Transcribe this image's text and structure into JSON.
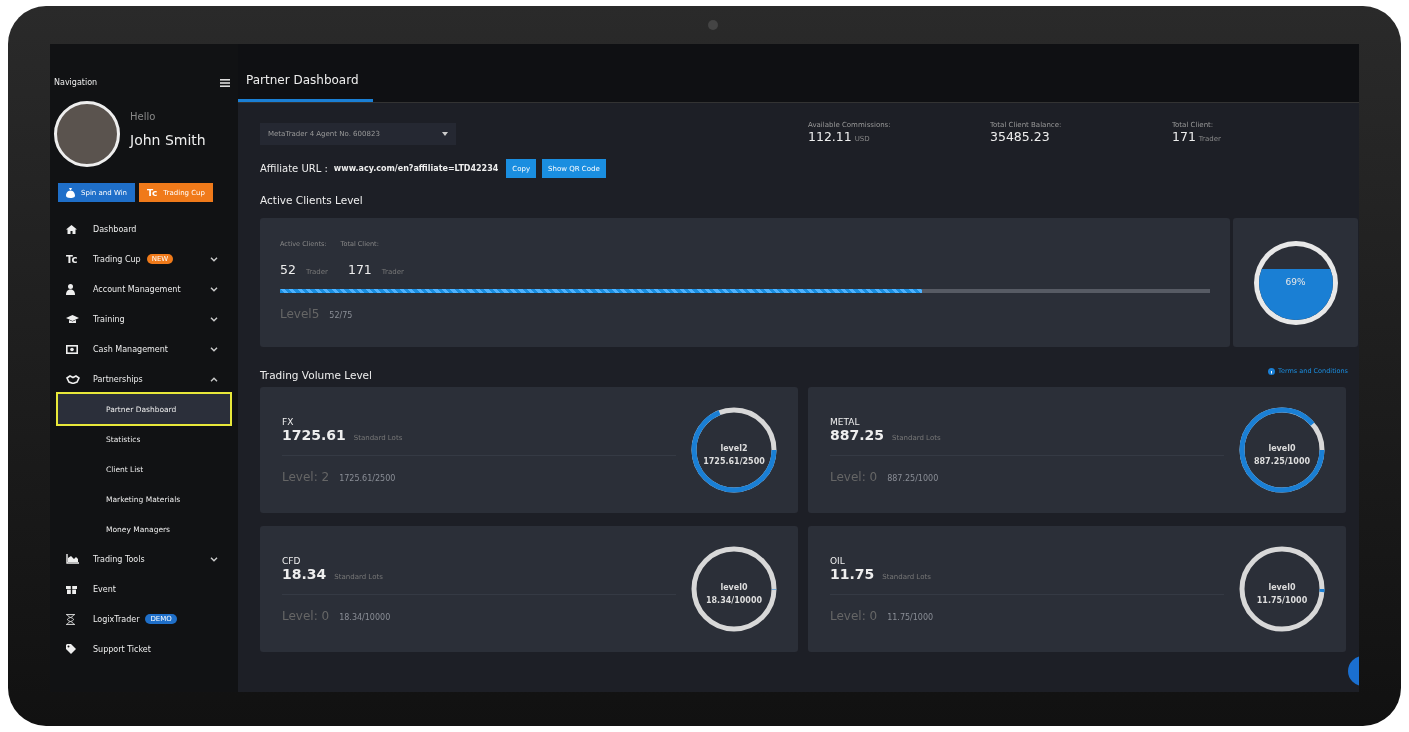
{
  "sidebar": {
    "title": "Navigation",
    "greeting": "Hello",
    "user_name": "John Smith",
    "promo_buttons": [
      {
        "kind": "spin",
        "label": "Spin and Win",
        "color": "#1f6fc9"
      },
      {
        "kind": "cup",
        "icon_text": "Tc",
        "label": "Trading Cup",
        "color": "#f07a1a"
      }
    ],
    "items": [
      {
        "kind": "link",
        "label": "Dashboard"
      },
      {
        "kind": "group",
        "icon_text": "Tc",
        "label": "Trading Cup",
        "badge": {
          "text": "NEW",
          "color": "#f07a1a"
        },
        "expanded": false
      },
      {
        "kind": "group",
        "label": "Account Management",
        "expanded": false
      },
      {
        "kind": "group",
        "label": "Training",
        "expanded": false
      },
      {
        "kind": "group",
        "label": "Cash Management",
        "expanded": false
      },
      {
        "kind": "group",
        "label": "Partnerships",
        "expanded": true,
        "children": [
          {
            "label": "Partner Dashboard",
            "selected": true
          },
          {
            "label": "Statistics",
            "selected": false
          },
          {
            "label": "Client List",
            "selected": false
          },
          {
            "label": "Marketing Materials",
            "selected": false
          },
          {
            "label": "Money Managers",
            "selected": false
          }
        ]
      },
      {
        "kind": "group",
        "label": "Trading Tools",
        "expanded": false
      },
      {
        "kind": "link",
        "label": "Event"
      },
      {
        "kind": "link",
        "label": "LogixTrader",
        "badge": {
          "text": "DEMO",
          "color": "#1f6fc9"
        }
      },
      {
        "kind": "link",
        "label": "Support Ticket"
      }
    ]
  },
  "tabs": [
    {
      "label": "Partner Dashboard",
      "selected": true
    }
  ],
  "account_select": {
    "value": "MetaTrader 4 Agent No. 600823"
  },
  "stats": [
    {
      "label": "Available Commissions:",
      "value": "112.11",
      "unit": "USD"
    },
    {
      "label": "Total Client Balance:",
      "value": "35485.23"
    },
    {
      "label": "Total Client:",
      "value": "171",
      "unit": "Trader"
    }
  ],
  "affiliate": {
    "label": "Affiliate URL :",
    "url": "www.acy.com/en?affiliate=LTD42234",
    "buttons": [
      "Copy",
      "Show QR Code"
    ]
  },
  "active_clients": {
    "title": "Active Clients Level",
    "active_label": "Active Clients:",
    "total_label": "Total Client:",
    "active_value": "52",
    "active_unit": "Trader",
    "total_value": "171",
    "total_unit": "Trader",
    "level": 0.69,
    "level_name": "Level5",
    "level_reading": "52/75",
    "gauge_reading": "69%"
  },
  "trading_volume": {
    "title": "Trading Volume Level",
    "terms_link": "Terms and Conditions",
    "cards": [
      {
        "name": "FX",
        "value": "1725.61",
        "unit": "Standard Lots",
        "level_text": "Level: 2",
        "reading": "1725.61/2500",
        "ring_label": "level2",
        "ring_reading": "1725.61/2500",
        "level": 0.69
      },
      {
        "name": "METAL",
        "value": "887.25",
        "unit": "Standard Lots",
        "level_text": "Level: 0",
        "reading": "887.25/1000",
        "ring_label": "level0",
        "ring_reading": "887.25/1000",
        "level": 0.887
      },
      {
        "name": "CFD",
        "value": "18.34",
        "unit": "Standard Lots",
        "level_text": "Level: 0",
        "reading": "18.34/10000",
        "ring_label": "level0",
        "ring_reading": "18.34/10000",
        "level": 0.002
      },
      {
        "name": "OIL",
        "value": "11.75",
        "unit": "Standard Lots",
        "level_text": "Level: 0",
        "reading": "11.75/1000",
        "ring_label": "level0",
        "ring_reading": "11.75/1000",
        "level": 0.012
      }
    ]
  }
}
